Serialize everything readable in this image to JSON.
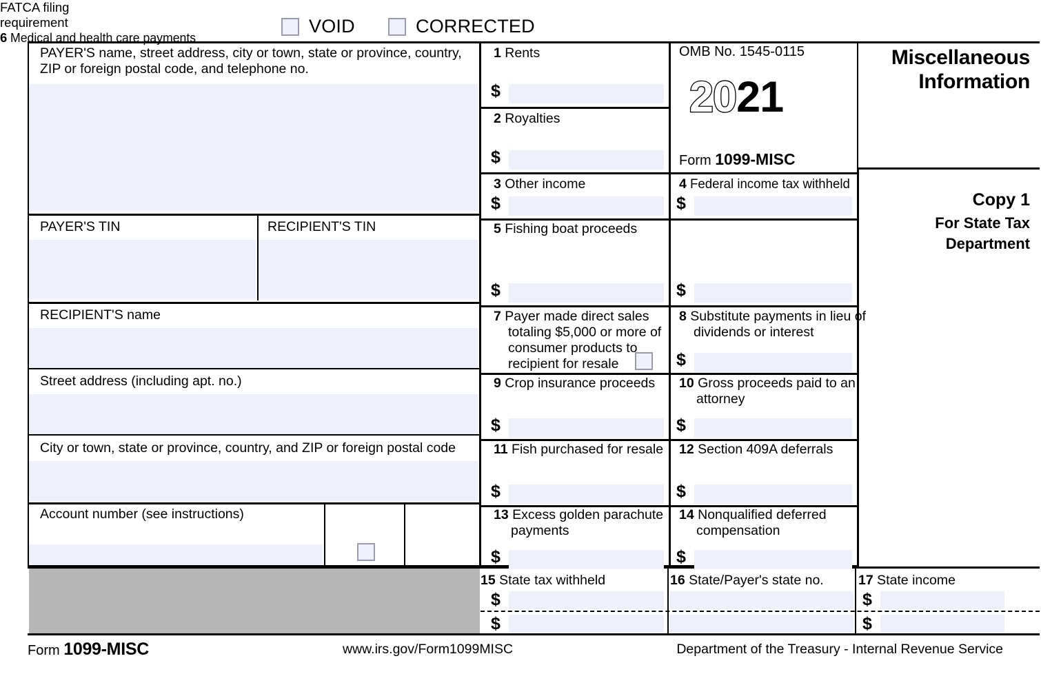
{
  "top_checkboxes": [
    {
      "label": "VOID",
      "checked": false
    },
    {
      "label": "CORRECTED",
      "checked": false
    }
  ],
  "payer": {
    "caption": "PAYER'S name, street address, city or town, state or province, country, ZIP or foreign postal code, and telephone no.",
    "value": ""
  },
  "payer_tin": {
    "caption": "PAYER'S TIN",
    "value": ""
  },
  "recipient_tin": {
    "caption": "RECIPIENT'S TIN",
    "value": ""
  },
  "recipient_name": {
    "caption": "RECIPIENT'S name",
    "value": ""
  },
  "street_address": {
    "caption": "Street address (including apt. no.)",
    "value": ""
  },
  "city_state_zip": {
    "caption": "City or town, state or province, country, and ZIP or foreign postal code",
    "value": ""
  },
  "account_number": {
    "caption": "Account number (see instructions)",
    "value": ""
  },
  "fatca": {
    "caption_line1": "FATCA filing",
    "caption_line2": "requirement",
    "checked": false
  },
  "omb": {
    "number": "OMB No. 1545-0115",
    "year_prefix": "20",
    "year_suffix": "21",
    "form_label": "Form",
    "form_name": "1099-MISC"
  },
  "masthead": {
    "line1": "Miscellaneous",
    "line2": "Information"
  },
  "copy": {
    "title": "Copy 1",
    "line1": "For State Tax",
    "line2": "Department"
  },
  "boxes": [
    {
      "num": "1",
      "label": "Rents",
      "dollar": "$",
      "value": ""
    },
    {
      "num": "2",
      "label": "Royalties",
      "dollar": "$",
      "value": ""
    },
    {
      "num": "3",
      "label": "Other income",
      "dollar": "$",
      "value": ""
    },
    {
      "num": "4",
      "label": "Federal income tax withheld",
      "dollar": "$",
      "value": ""
    },
    {
      "num": "5",
      "label": "Fishing boat proceeds",
      "dollar": "$",
      "value": ""
    },
    {
      "num": "6",
      "label": "Medical and health care payments",
      "dollar": "$",
      "value": ""
    },
    {
      "num": "7",
      "label_line1": "Payer made direct sales",
      "label_line2": "totaling $5,000 or more of",
      "label_line3": "consumer products to",
      "label_line4": "recipient for resale",
      "checked": false
    },
    {
      "num": "8",
      "label_line1": "Substitute payments in lieu of",
      "label_line2": "dividends or interest",
      "dollar": "$",
      "value": ""
    },
    {
      "num": "9",
      "label": "Crop insurance proceeds",
      "dollar": "$",
      "value": ""
    },
    {
      "num": "10",
      "label_line1": "Gross proceeds paid to an",
      "label_line2": "attorney",
      "dollar": "$",
      "value": ""
    },
    {
      "num": "11",
      "label": "Fish purchased for resale",
      "dollar": "$",
      "value": ""
    },
    {
      "num": "12",
      "label": "Section 409A deferrals",
      "dollar": "$",
      "value": ""
    },
    {
      "num": "13",
      "label_line1": "Excess golden parachute",
      "label_line2": "payments",
      "dollar": "$",
      "value": ""
    },
    {
      "num": "14",
      "label_line1": "Nonqualified deferred",
      "label_line2": "compensation",
      "dollar": "$",
      "value": ""
    },
    {
      "num": "15",
      "label": "State tax withheld",
      "dollar": "$",
      "value_row1": "",
      "value_row2": ""
    },
    {
      "num": "16",
      "label": "State/Payer's state no.",
      "value_row1": "",
      "value_row2": ""
    },
    {
      "num": "17",
      "label": "State income",
      "dollar": "$",
      "value_row1": "",
      "value_row2": ""
    }
  ],
  "footer": {
    "form_label": "Form",
    "form_name": "1099-MISC",
    "url": "www.irs.gov/Form1099MISC",
    "agency": "Department of the Treasury - Internal Revenue Service"
  },
  "colors": {
    "field_fill": "#eef0fb",
    "gray_block": "#b6b6b6",
    "checkbox_border": "#9a9aac",
    "rule": "#000000"
  }
}
